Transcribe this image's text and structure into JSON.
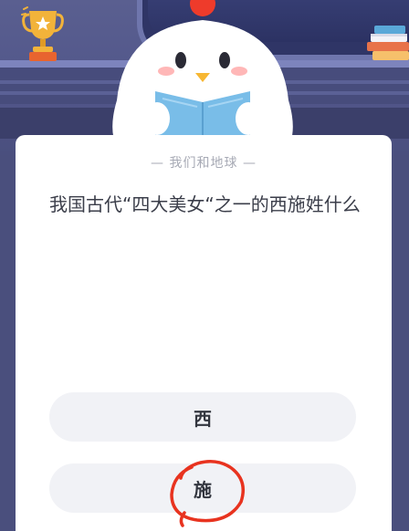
{
  "card": {
    "category_label": "— 我们和地球 —",
    "question": "我国古代“四大美女“之一的西施姓什么"
  },
  "options": [
    {
      "label": "西"
    },
    {
      "label": "施"
    }
  ],
  "colors": {
    "background": "#4a4f7d",
    "card": "#ffffff",
    "option_bg": "#f1f2f6",
    "annotation_circle": "#e8331f",
    "trophy": "#f2b33a"
  },
  "icons": {
    "trophy": "trophy-icon",
    "mascot": "chicken-mascot",
    "books": "books-icon"
  }
}
